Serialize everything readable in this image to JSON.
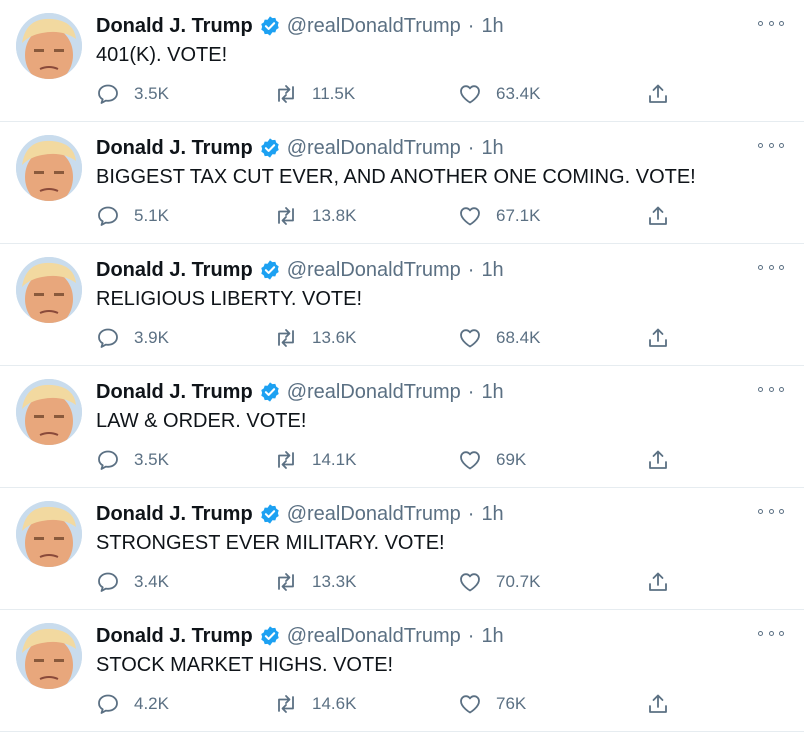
{
  "colors": {
    "text": "#0f1419",
    "muted": "#5b7083",
    "verified": "#1da1f2",
    "divider": "#e6ecf0"
  },
  "icons": {
    "verified": "verified-badge-icon",
    "more": "more-horizontal-icon",
    "reply": "reply-bubble-icon",
    "retweet": "retweet-icon",
    "like": "heart-icon",
    "share": "share-upload-icon"
  },
  "tweets": [
    {
      "name": "Donald J. Trump",
      "handle": "@realDonaldTrump",
      "separator": "·",
      "time": "1h",
      "text": "401(K). VOTE!",
      "replies": "3.5K",
      "retweets": "11.5K",
      "likes": "63.4K"
    },
    {
      "name": "Donald J. Trump",
      "handle": "@realDonaldTrump",
      "separator": "·",
      "time": "1h",
      "text": "BIGGEST TAX CUT EVER, AND ANOTHER ONE COMING. VOTE!",
      "replies": "5.1K",
      "retweets": "13.8K",
      "likes": "67.1K"
    },
    {
      "name": "Donald J. Trump",
      "handle": "@realDonaldTrump",
      "separator": "·",
      "time": "1h",
      "text": "RELIGIOUS LIBERTY. VOTE!",
      "replies": "3.9K",
      "retweets": "13.6K",
      "likes": "68.4K"
    },
    {
      "name": "Donald J. Trump",
      "handle": "@realDonaldTrump",
      "separator": "·",
      "time": "1h",
      "text": "LAW & ORDER. VOTE!",
      "replies": "3.5K",
      "retweets": "14.1K",
      "likes": "69K"
    },
    {
      "name": "Donald J. Trump",
      "handle": "@realDonaldTrump",
      "separator": "·",
      "time": "1h",
      "text": "STRONGEST EVER MILITARY. VOTE!",
      "replies": "3.4K",
      "retweets": "13.3K",
      "likes": "70.7K"
    },
    {
      "name": "Donald J. Trump",
      "handle": "@realDonaldTrump",
      "separator": "·",
      "time": "1h",
      "text": "STOCK MARKET HIGHS. VOTE!",
      "replies": "4.2K",
      "retweets": "14.6K",
      "likes": "76K"
    }
  ]
}
